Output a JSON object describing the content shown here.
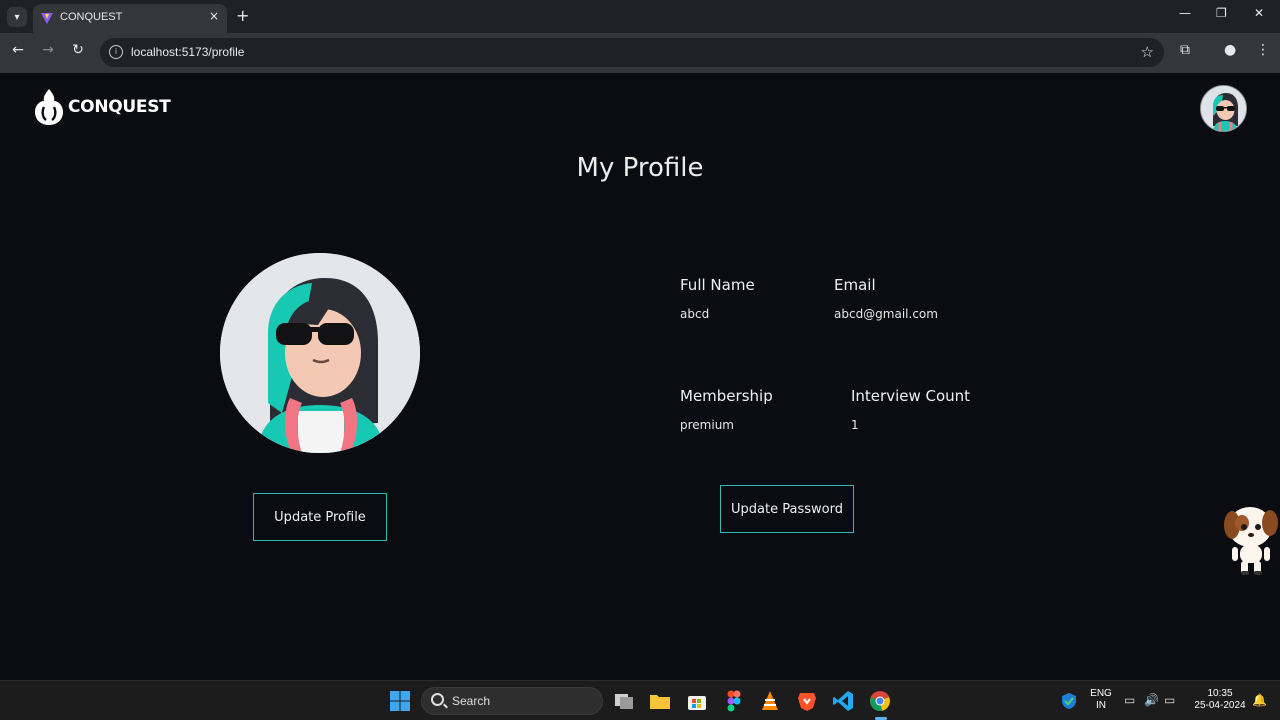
{
  "browser": {
    "tab_title": "CONQUEST",
    "tab_close": "×",
    "new_tab": "+",
    "url": "localhost:5173/profile",
    "window_controls": {
      "minimize": "—",
      "restore": "❐",
      "close": "✕"
    }
  },
  "app": {
    "logo_text": "CONQUEST"
  },
  "profile": {
    "title": "My Profile",
    "update_profile_label": "Update Profile",
    "update_password_label": "Update Password",
    "fields": {
      "full_name_label": "Full Name",
      "full_name_value": "abcd",
      "email_label": "Email",
      "email_value": "abcd@gmail.com",
      "membership_label": "Membership",
      "membership_value": "premium",
      "interview_count_label": "Interview Count",
      "interview_count_value": "1"
    }
  },
  "taskbar": {
    "search_label": "Search",
    "lang_line1": "ENG",
    "lang_line2": "IN",
    "time": "10:35",
    "date": "25-04-2024"
  },
  "colors": {
    "page_bg": "#0a0c11",
    "button_border": "#2fb9b4",
    "text": "#f0f0f0"
  }
}
